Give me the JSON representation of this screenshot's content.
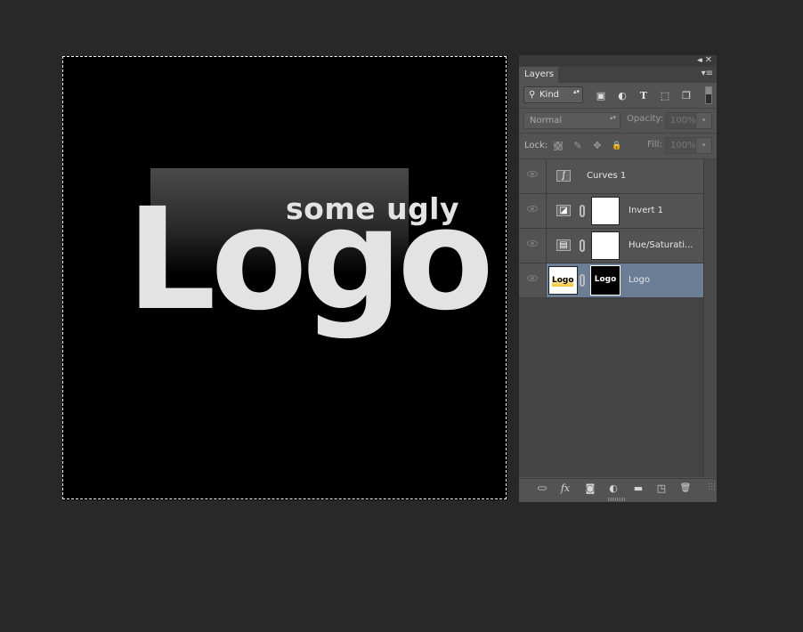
{
  "canvas": {
    "tagline": "some ugly",
    "logo": "Logo",
    "background": "#000000",
    "text_color": "#e3e3e3"
  },
  "panel": {
    "collapse_icon": "collapse-icon",
    "close_icon": "close-icon",
    "tab_label": "Layers",
    "menu_icon": "panel-menu-icon",
    "filter": {
      "kind_label": "Kind",
      "icons": [
        "image-filter-icon",
        "adjustment-filter-icon",
        "type-filter-icon",
        "shape-filter-icon",
        "smart-object-filter-icon"
      ]
    },
    "blend_mode": "Normal",
    "opacity_label": "Opacity:",
    "opacity_value": "100%",
    "lock_label": "Lock:",
    "lock_icons": [
      "lock-transparent-icon",
      "lock-image-icon",
      "lock-position-icon",
      "lock-all-icon"
    ],
    "fill_label": "Fill:",
    "fill_value": "100%",
    "selection_color": "#6c7d96",
    "layers": [
      {
        "name": "Curves 1",
        "type": "curves-adjustment",
        "visible": true,
        "has_mask": false,
        "selected": false
      },
      {
        "name": "Invert 1",
        "type": "invert-adjustment",
        "visible": true,
        "has_mask": true,
        "selected": false
      },
      {
        "name": "Hue/Saturati...",
        "type": "hue-saturation-adjustment",
        "visible": true,
        "has_mask": true,
        "selected": false
      },
      {
        "name": "Logo",
        "type": "image",
        "visible": true,
        "has_mask": true,
        "selected": true,
        "thumb_text": "Logo",
        "mask_text": "Logo"
      }
    ],
    "bottom_icons": [
      "link-layers-icon",
      "fx-icon",
      "add-mask-icon",
      "new-adjustment-icon",
      "new-group-icon",
      "new-layer-icon",
      "delete-layer-icon"
    ],
    "glyphs": {
      "collapse": "◂◂",
      "close": "✕",
      "menu": "▾≡",
      "search": "⚲",
      "updown": "▴▾",
      "dropdown": "▾",
      "image": "▣",
      "adjust": "◐",
      "type": "T",
      "shape": "⬚",
      "smart": "❐",
      "brush": "✎",
      "move": "✥",
      "lock": "🔒",
      "curves": "∫",
      "invert": "◪",
      "hue": "▤",
      "link": "⊂⊃",
      "fx": "fx",
      "mask": "◙",
      "adjustment": "◐",
      "folder": "▬",
      "newlayer": "◳",
      "trash": "🗑"
    }
  }
}
